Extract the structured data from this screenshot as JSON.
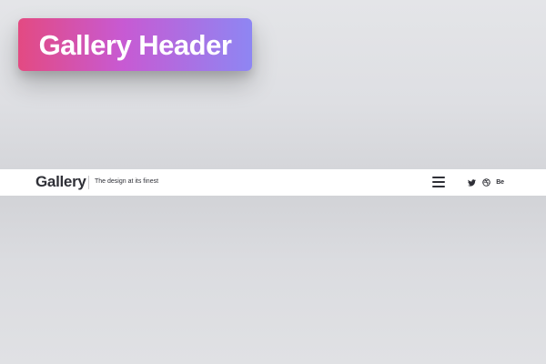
{
  "badge": {
    "text": "Gallery Header"
  },
  "header": {
    "logo": "Gallery",
    "tagline": "The design at its finest",
    "menu_icon": "hamburger-menu-icon",
    "social": [
      {
        "icon": "twitter-icon"
      },
      {
        "icon": "dribbble-icon"
      },
      {
        "icon": "behance-icon",
        "label": "Be"
      }
    ]
  },
  "colors": {
    "badge_gradient_start": "#e34a82",
    "badge_gradient_mid": "#c75ad3",
    "badge_gradient_end": "#8e86f3",
    "header_background": "#ffffff",
    "text_dark": "#2f3037",
    "page_background": "#dedfe3"
  }
}
